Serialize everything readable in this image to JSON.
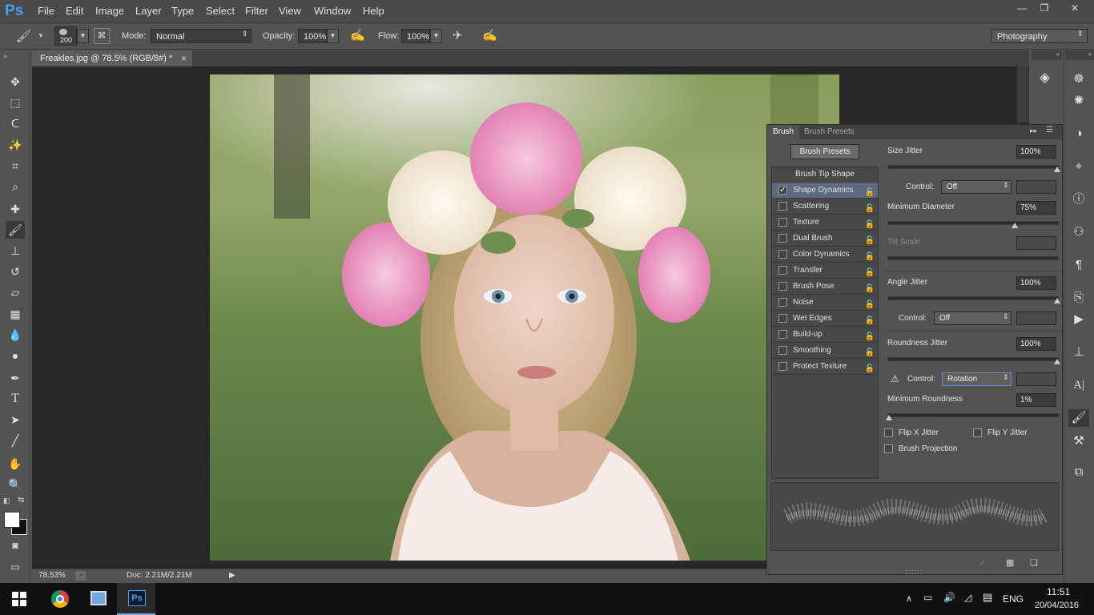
{
  "app": {
    "logo": "Ps"
  },
  "menu": [
    "File",
    "Edit",
    "Image",
    "Layer",
    "Type",
    "Select",
    "Filter",
    "View",
    "Window",
    "Help"
  ],
  "window_controls": {
    "minimize": "—",
    "restore": "❐",
    "close": "✕"
  },
  "options": {
    "brush_size": "200",
    "mode_label": "Mode:",
    "mode_value": "Normal",
    "opacity_label": "Opacity:",
    "opacity_value": "100%",
    "flow_label": "Flow:",
    "flow_value": "100%",
    "workspace": "Photography"
  },
  "document": {
    "tab_title": "Freakles.jpg @ 78.5% (RGB/8#) *",
    "tab_close": "×",
    "zoom": "78.53%",
    "doc_info": "Doc: 2.21M/2.21M"
  },
  "brush_panel": {
    "tabs": [
      "Brush",
      "Brush Presets"
    ],
    "presets_button": "Brush Presets",
    "tip_shape_header": "Brush Tip Shape",
    "items": [
      {
        "label": "Shape Dynamics",
        "checked": true
      },
      {
        "label": "Scattering",
        "checked": false
      },
      {
        "label": "Texture",
        "checked": false
      },
      {
        "label": "Dual Brush",
        "checked": false
      },
      {
        "label": "Color Dynamics",
        "checked": false
      },
      {
        "label": "Transfer",
        "checked": false
      },
      {
        "label": "Brush Pose",
        "checked": false
      },
      {
        "label": "Noise",
        "checked": false
      },
      {
        "label": "Wet Edges",
        "checked": false
      },
      {
        "label": "Build-up",
        "checked": false
      },
      {
        "label": "Smoothing",
        "checked": false
      },
      {
        "label": "Protect Texture",
        "checked": false
      }
    ],
    "size_jitter": {
      "label": "Size Jitter",
      "value": "100%",
      "level": 1.0
    },
    "size_control": {
      "label": "Control:",
      "value": "Off"
    },
    "min_diameter": {
      "label": "Minimum Diameter",
      "value": "75%",
      "level": 0.75
    },
    "tilt_scale": {
      "label": "Tilt Scale"
    },
    "angle_jitter": {
      "label": "Angle Jitter",
      "value": "100%",
      "level": 1.0
    },
    "angle_control": {
      "label": "Control:",
      "value": "Off"
    },
    "roundness_jitter": {
      "label": "Roundness Jitter",
      "value": "100%",
      "level": 1.0
    },
    "roundness_control": {
      "label": "Control:",
      "value": "Rotation"
    },
    "min_roundness": {
      "label": "Minimum Roundness",
      "value": "1%",
      "level": 0.01
    },
    "flip_x": "Flip X Jitter",
    "flip_y": "Flip Y Jitter",
    "brush_projection": "Brush Projection"
  },
  "taskbar": {
    "language": "ENG",
    "time": "11:51",
    "date": "20/04/2016"
  },
  "colors": {
    "ps_blue": "#3fa2f4",
    "panel": "#535353",
    "canvas_bg": "#282828"
  }
}
